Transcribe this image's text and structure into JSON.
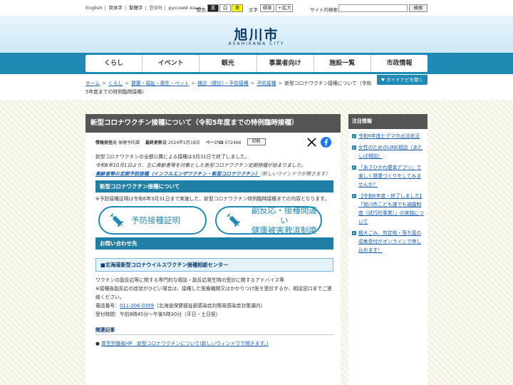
{
  "util": {
    "languages": [
      "English",
      "简体字",
      "繁體字",
      "한국어",
      "русский язык"
    ],
    "color_label": "配色",
    "color_options": [
      "黒",
      "白",
      "黄"
    ],
    "text_label": "文字",
    "text_options": [
      "標準",
      "＋拡大"
    ],
    "search_label": "サイト内検索",
    "search_placeholder": "",
    "search_button": "検索"
  },
  "header": {
    "logo": "旭川市",
    "logo_sub": "ASAHIKAWA CITY"
  },
  "nav": [
    "くらし",
    "イベント",
    "観光",
    "事業者向け",
    "施設一覧",
    "市政情報"
  ],
  "breadcrumb": {
    "items": [
      "ホーム",
      "くらし",
      "健康・福祉・衛生・ペット",
      "検診（健診）・予防接種",
      "予防接種"
    ],
    "current": "新型コロナワクチン接種について（令和5年度までの特例臨時接種）"
  },
  "guide_button": "ガイドナビを開く",
  "page": {
    "title": "新型コロナワクチン接種について（令和5年度までの特例臨時接種）",
    "meta": {
      "issuer_label": "情報発信元",
      "issuer": "保健予防課",
      "updated_label": "最終更新日",
      "updated": "2024年5月18日",
      "pageid_label": "ページID",
      "pageid": "072466",
      "print": "印刷"
    },
    "intro1": "新型コロナワクチンの全額公費による接種は3月31日で終了しました。",
    "intro2": "令和6年10月1日より、主に高齢者等を対象とした新型コロナワクチン定期接種が始まりました。",
    "intro_link": "高齢者等の定期予防接種（インフルエンザワクチン・新型コロナワクチン）",
    "intro_link_note": "（新しいウインドウが開きます）",
    "section1": "新型コロナワクチン接種について",
    "section1_text": "※予防接種証明は令和6年3月31日まで実施した、新型コロナワクチン特例臨時接種までの内容となります。",
    "pill1": "予防接種証明",
    "pill2_line1": "副反応・接種間違い",
    "pill2_line2": "健康被害救済制度",
    "section2": "お問い合わせ先",
    "center_name": "■北海道新型コロナウイルスワクチン接種相談センター",
    "center_line1": "ワクチンの副反応等に関する専門的な相談・副反応発生時の受診に関するアドバイス等",
    "center_line2": "※接種後副反応の症状がひどい場合は、接種した医療機関又はかかりつけ医を受診するか、相談窓口までご連絡ください。",
    "phone_label": "電話番号：",
    "phone": "011-206-0359",
    "phone_note": "（北海道保健福祉部感染症対策局感染症対策課内）",
    "hours": "受付時間：午前8時45分～午後5時30分（平日・土日祝）",
    "related_h": "関連記事",
    "related_link": "厚生労働省HP　新型コロナワクチンについて(新しいウィンドウで開きます。)"
  },
  "sidebar": {
    "title": "注目情報",
    "items": [
      "令和6年度ヒグマの出没状況",
      "女性のためのLINE相談（あたしば相談）",
      "「あさひかわ健幸アプリ」で楽しく健康づくりをしてみませんか？",
      "【令和6年度・終了しました】「旭川市こども誰でも通園制度（試行的事業）」の実施について",
      "粗大ごみ、剪定枝・落ち葉の収集受付がオンラインで申し込めます！"
    ]
  },
  "colors": {
    "accent": "#1f8ab3",
    "title_bar": "#555555",
    "logo": "#0c3b6e"
  }
}
